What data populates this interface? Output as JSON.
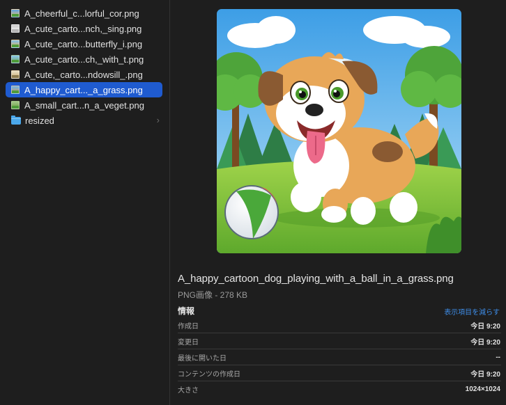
{
  "files": [
    {
      "name": "A_cheerful_c...lorful_cor.png",
      "thumb_icon": "image-thumbnail-icon",
      "selected": false
    },
    {
      "name": "A_cute_carto...nch,_sing.png",
      "thumb_icon": "image-thumbnail-icon",
      "selected": false
    },
    {
      "name": "A_cute_carto...butterfly_i.png",
      "thumb_icon": "image-thumbnail-icon",
      "selected": false
    },
    {
      "name": "A_cute_carto...ch,_with_t.png",
      "thumb_icon": "image-thumbnail-icon",
      "selected": false
    },
    {
      "name": "A_cute,_carto...ndowsill_.png",
      "thumb_icon": "image-thumbnail-icon",
      "selected": false
    },
    {
      "name": "A_happy_cart..._a_grass.png",
      "thumb_icon": "image-thumbnail-icon",
      "selected": true
    },
    {
      "name": "A_small_cart...n_a_veget.png",
      "thumb_icon": "image-thumbnail-icon",
      "selected": false
    }
  ],
  "folder": {
    "name": "resized",
    "icon": "folder-icon",
    "chevron": "›"
  },
  "preview": {
    "image_description": "cartoon-dog-playing-with-ball-on-grass",
    "title": "A_happy_cartoon_dog_playing_with_a_ball_in_a_grass.png",
    "subtitle": "PNG画像 - 278 KB"
  },
  "info": {
    "header": "情報",
    "show_less": "表示項目を減らす",
    "rows": [
      {
        "label": "作成日",
        "value": "今日 9:20"
      },
      {
        "label": "変更日",
        "value": "今日 9:20"
      },
      {
        "label": "最後に開いた日",
        "value": "--"
      },
      {
        "label": "コンテンツの作成日",
        "value": "今日 9:20"
      },
      {
        "label": "大きさ",
        "value": "1024×1024"
      }
    ]
  },
  "colors": {
    "background": "#1e1e1e",
    "selection": "#1f5bd0",
    "link": "#3e8de8",
    "folder": "#4aa7ea"
  }
}
